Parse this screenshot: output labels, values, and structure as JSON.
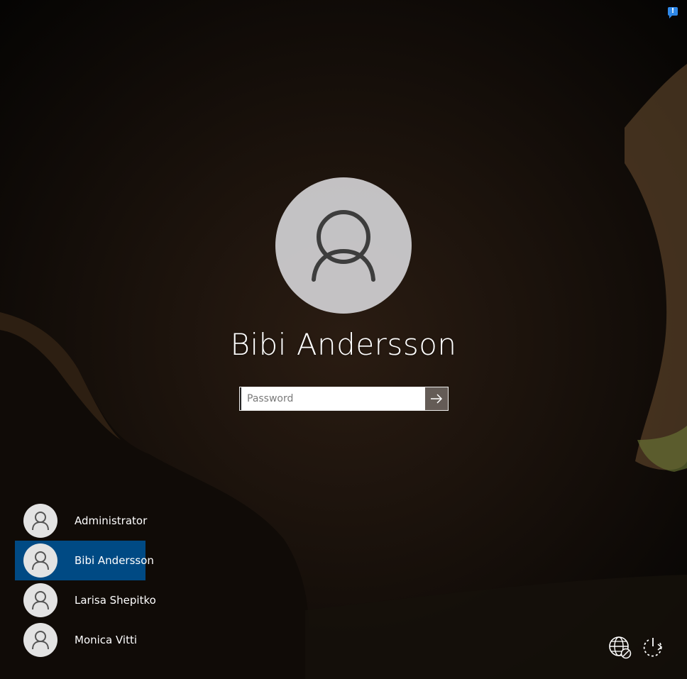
{
  "lock_screen": {
    "user": {
      "name": "Bibi Andersson",
      "avatar_icon": "user-icon"
    },
    "password": {
      "value": "",
      "placeholder": "Password",
      "submit_icon": "arrow-right-icon"
    }
  },
  "user_list": {
    "users": [
      {
        "name": "Administrator",
        "icon": "user-icon",
        "selected": false
      },
      {
        "name": "Bibi Andersson",
        "icon": "user-icon",
        "selected": true
      },
      {
        "name": "Larisa Shepitko",
        "icon": "user-icon",
        "selected": false
      },
      {
        "name": "Monica Vitti",
        "icon": "user-icon",
        "selected": false
      }
    ]
  },
  "corner": {
    "notification_icon": "notification-icon",
    "network_icon": "network-globe-icon",
    "power_icon": "power-icon"
  },
  "colors": {
    "selected_user_bg": "#004a84",
    "notification": "#2f88e8"
  }
}
